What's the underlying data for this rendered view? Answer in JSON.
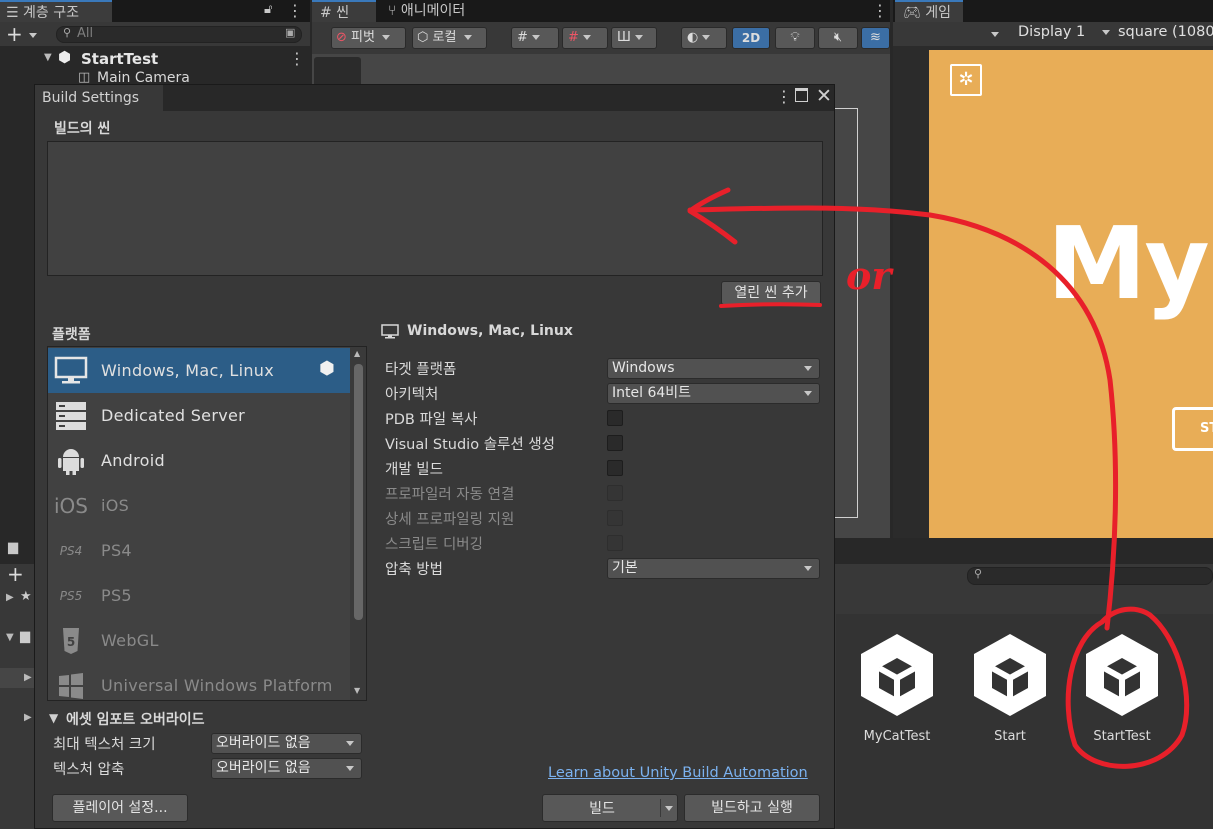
{
  "hierarchy": {
    "tab_label": "계층 구조",
    "search_placeholder": "All",
    "scene_name": "StartTest",
    "child_item": "Main Camera"
  },
  "scene_view": {
    "tab_scene": "씬",
    "tab_animator": "애니메이터",
    "pivot_label": "피벗",
    "local_label": "로컬",
    "mode_2d": "2D"
  },
  "game_view": {
    "tab_label": "게임",
    "display_label": "Display 1",
    "aspect_label": "square (1080",
    "title_text": "My",
    "start_button_partial": "ST",
    "background_color": "#e8ad57"
  },
  "build_settings": {
    "window_title": "Build Settings",
    "scenes_header": "빌드의 씬",
    "add_open_scenes_button": "열린 씬 추가",
    "platform_header": "플랫폼",
    "platforms": [
      {
        "label": "Windows, Mac, Linux",
        "icon": "monitor-icon",
        "selected": true,
        "dim": false
      },
      {
        "label": "Dedicated Server",
        "icon": "server-icon",
        "selected": false,
        "dim": false
      },
      {
        "label": "Android",
        "icon": "android-icon",
        "selected": false,
        "dim": false
      },
      {
        "label": "iOS",
        "icon": "ios-icon",
        "selected": false,
        "dim": true
      },
      {
        "label": "PS4",
        "icon": "ps4-icon",
        "selected": false,
        "dim": true
      },
      {
        "label": "PS5",
        "icon": "ps5-icon",
        "selected": false,
        "dim": true
      },
      {
        "label": "WebGL",
        "icon": "html5-icon",
        "selected": false,
        "dim": true
      },
      {
        "label": "Universal Windows Platform",
        "icon": "windows-icon",
        "selected": false,
        "dim": true
      }
    ],
    "selected_platform_title": "Windows, Mac, Linux",
    "settings": {
      "target_platform_label": "타겟 플랫폼",
      "target_platform_value": "Windows",
      "architecture_label": "아키텍처",
      "architecture_value": "Intel 64비트",
      "pdb_copy_label": "PDB 파일 복사",
      "vs_solution_label": "Visual Studio 솔루션 생성",
      "dev_build_label": "개발 빌드",
      "autoconnect_profiler_label": "프로파일러 자동 연결",
      "deep_profiling_label": "상세 프로파일링 지원",
      "script_debugging_label": "스크립트 디버깅",
      "compression_label": "압축 방법",
      "compression_value": "기본"
    },
    "asset_import_overrides_header": "에셋 임포트 오버라이드",
    "max_texture_size_label": "최대 텍스처 크기",
    "max_texture_size_value": "오버라이드 없음",
    "texture_compression_label": "텍스처 압축",
    "texture_compression_value": "오버라이드 없음",
    "learn_link": "Learn about Unity Build Automation",
    "player_settings_button": "플레이어 설정...",
    "build_button": "빌드",
    "build_and_run_button": "빌드하고 실행"
  },
  "project_assets": [
    {
      "label": "MyCatTest"
    },
    {
      "label": "Start"
    },
    {
      "label": "StartTest"
    }
  ],
  "annotation": {
    "or_text": "or",
    "color": "#e8202a"
  }
}
